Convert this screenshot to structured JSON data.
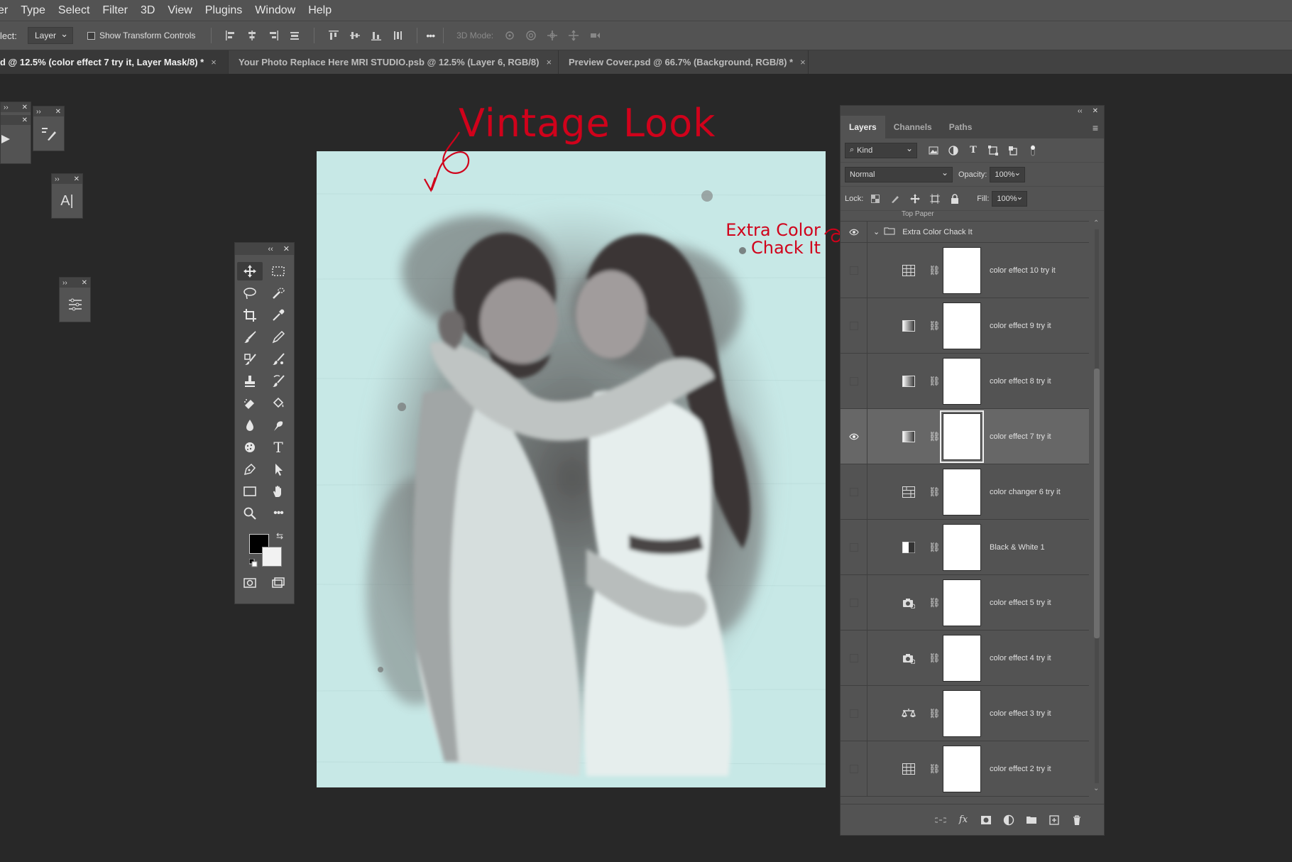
{
  "menu": [
    "er",
    "Type",
    "Select",
    "Filter",
    "3D",
    "View",
    "Plugins",
    "Window",
    "Help"
  ],
  "options": {
    "select_label": "lect:",
    "select_value": "Layer",
    "show_transform": "Show Transform Controls",
    "mode_3d": "3D Mode:",
    "more": "•••"
  },
  "tabs": [
    {
      "label": "d @ 12.5% (color effect 7 try it, Layer Mask/8) *"
    },
    {
      "label": "Your Photo Replace Here MRI STUDIO.psb @ 12.5% (Layer 6, RGB/8)"
    },
    {
      "label": "Preview Cover.psd @ 66.7% (Background, RGB/8) *"
    }
  ],
  "tab_close": "×",
  "annotations": {
    "title": "Vintage Look",
    "extra_line1": "Extra Color",
    "extra_line2": "Chack It"
  },
  "layers_panel": {
    "tabs": [
      "Layers",
      "Channels",
      "Paths"
    ],
    "kind": "Kind",
    "blend": "Normal",
    "opacity_label": "Opacity:",
    "opacity": "100%",
    "lock_label": "Lock:",
    "fill_label": "Fill:",
    "fill": "100%",
    "group_above": "Top Paper",
    "group": "Extra Color Chack It",
    "layers": [
      {
        "name": "color effect 10 try it",
        "icon": "channel-mixer-icon",
        "visible": false
      },
      {
        "name": "color effect 9 try it",
        "icon": "gradient-map-icon",
        "visible": false
      },
      {
        "name": "color effect 8 try it",
        "icon": "gradient-map-icon",
        "visible": false
      },
      {
        "name": "color effect 7 try it",
        "icon": "gradient-map-icon",
        "visible": true,
        "selected": true
      },
      {
        "name": "color changer 6 try it",
        "icon": "channel-mixer-icon",
        "visible": false
      },
      {
        "name": "Black & White 1",
        "icon": "black-white-icon",
        "visible": false
      },
      {
        "name": "color effect 5 try it",
        "icon": "photo-filter-icon",
        "visible": false
      },
      {
        "name": "color effect 4 try it",
        "icon": "photo-filter-icon",
        "visible": false
      },
      {
        "name": "color effect 3 try it",
        "icon": "color-balance-icon",
        "visible": false
      },
      {
        "name": "color effect 2 try it",
        "icon": "channel-mixer-icon",
        "visible": false
      }
    ]
  },
  "colors": {
    "annotation": "#d0021b",
    "canvas_bg": "#c7e8e6",
    "foreground": "#000000",
    "background": "#f2f2f2"
  }
}
